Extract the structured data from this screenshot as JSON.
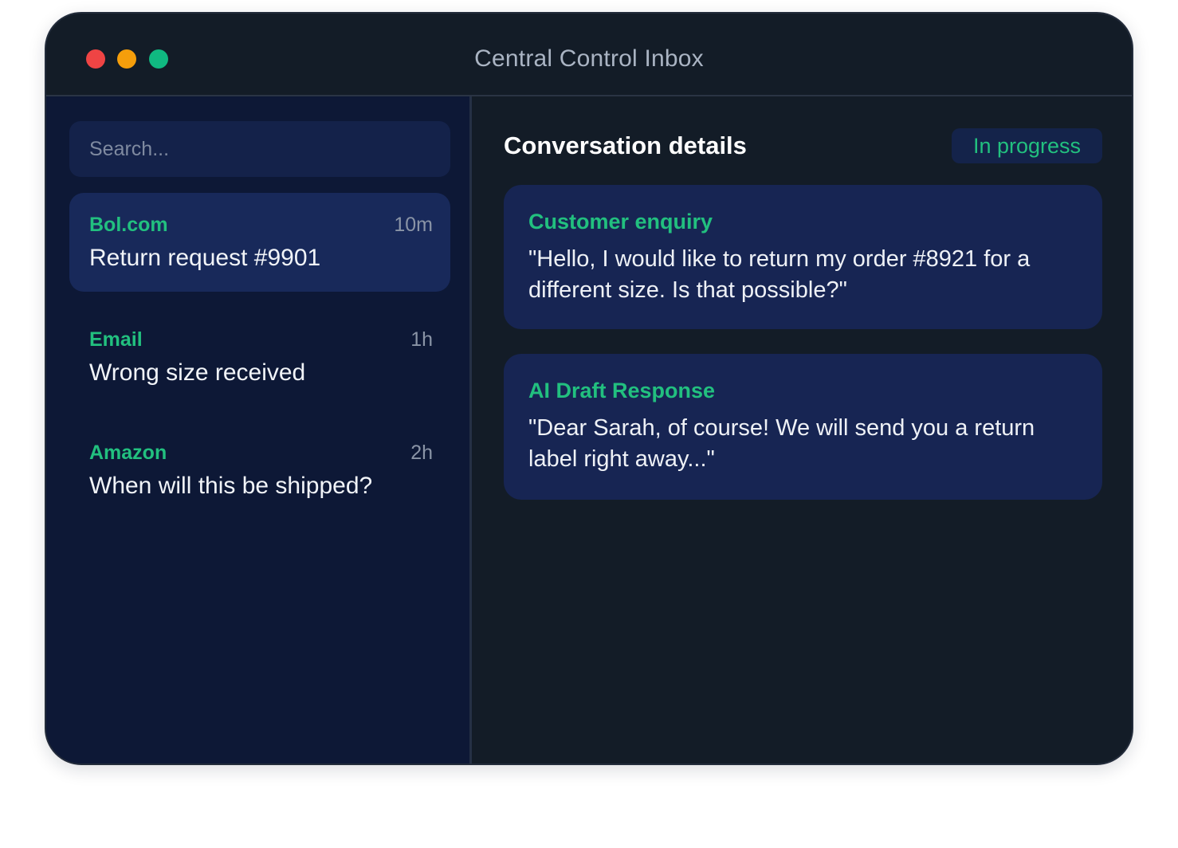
{
  "window": {
    "title": "Central Control Inbox"
  },
  "sidebar": {
    "search_placeholder": "Search...",
    "conversations": [
      {
        "source": "Bol.com",
        "time": "10m",
        "subject": "Return request #9901",
        "active": true
      },
      {
        "source": "Email",
        "time": "1h",
        "subject": "Wrong size received",
        "active": false
      },
      {
        "source": "Amazon",
        "time": "2h",
        "subject": "When will this be shipped?",
        "active": false
      }
    ]
  },
  "main": {
    "title": "Conversation details",
    "status": "In progress",
    "cards": [
      {
        "title": "Customer enquiry",
        "body": "\"Hello, I would like to return my order #8921 for a different size. Is that possible?\""
      },
      {
        "title": "AI Draft Response",
        "body": "\"Dear Sarah, of course! We will send you a return label right away...\""
      }
    ]
  },
  "colors": {
    "accent_green": "#22c07f",
    "window_bg": "#131c27",
    "sidebar_bg": "#0d1836",
    "card_bg": "#172553",
    "close_dot": "#ef4444",
    "minimize_dot": "#f59e0b",
    "maximize_dot": "#10b981"
  }
}
